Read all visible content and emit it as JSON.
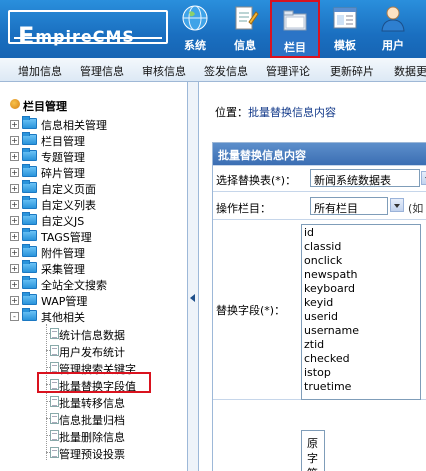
{
  "header": {
    "logo_first": "E",
    "logo_rest": "mpireCMS",
    "nav": [
      {
        "label": "系统",
        "icon": "globe-icon"
      },
      {
        "label": "信息",
        "icon": "notepad-icon"
      },
      {
        "label": "栏目",
        "icon": "folder-icon",
        "active": true
      },
      {
        "label": "模板",
        "icon": "template-window-icon"
      },
      {
        "label": "用户",
        "icon": "user-icon"
      }
    ],
    "active_border_color": "#d9121e"
  },
  "menu": {
    "items": [
      "增加信息",
      "管理信息",
      "审核信息",
      "签发信息",
      "管理评论",
      "更新碎片",
      "数据更"
    ]
  },
  "tree": {
    "title": "栏目管理",
    "items": [
      {
        "label": "信息相关管理",
        "toggle": "+"
      },
      {
        "label": "栏目管理",
        "toggle": "+"
      },
      {
        "label": "专题管理",
        "toggle": "+"
      },
      {
        "label": "碎片管理",
        "toggle": "+"
      },
      {
        "label": "自定义页面",
        "toggle": "+"
      },
      {
        "label": "自定义列表",
        "toggle": "+"
      },
      {
        "label": "自定义JS",
        "toggle": "+"
      },
      {
        "label": "TAGS管理",
        "toggle": "+"
      },
      {
        "label": "附件管理",
        "toggle": "+"
      },
      {
        "label": "采集管理",
        "toggle": "+"
      },
      {
        "label": "全站全文搜索",
        "toggle": "+"
      },
      {
        "label": "WAP管理",
        "toggle": "+"
      },
      {
        "label": "其他相关",
        "toggle": "-"
      }
    ],
    "subitems": [
      "统计信息数据",
      "用户发布统计",
      "管理搜索关键字",
      "批量替换字段值",
      "批量转移信息",
      "信息批量归档",
      "批量删除信息",
      "管理预设投票"
    ],
    "selected": "批量替换字段值"
  },
  "content": {
    "location_prefix": "位置：",
    "location_link": "批量替换信息内容",
    "panel_title": "批量替换信息内容",
    "select_table_label": "选择替换表(*)：",
    "select_table_value": "新闻系统数据表",
    "column_label": "操作栏目：",
    "column_value": "所有栏目",
    "column_hint": "(如",
    "field_label": "替换字段(*)：",
    "fields": [
      "id",
      "classid",
      "onclick",
      "newspath",
      "keyboard",
      "keyid",
      "userid",
      "username",
      "ztid",
      "checked",
      "istop",
      "truetime"
    ],
    "original_label_1": "原",
    "original_label_2": "字",
    "original_label_3": "符"
  }
}
